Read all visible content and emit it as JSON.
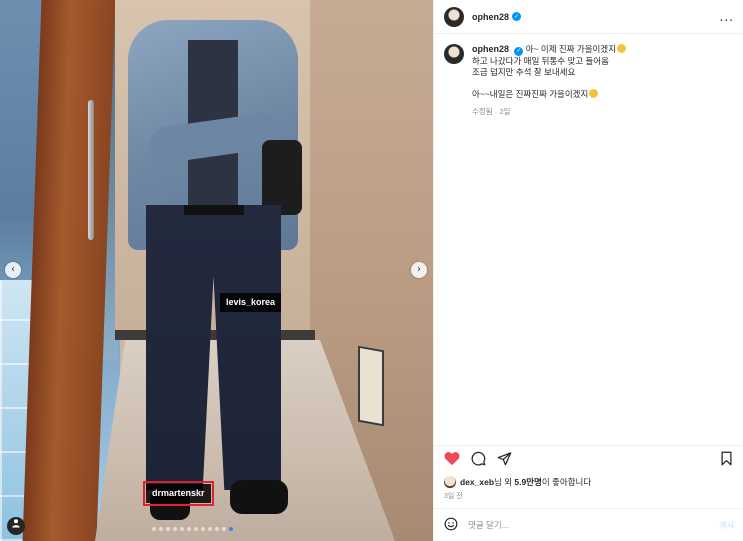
{
  "photo": {
    "tags": [
      {
        "label": "levis_korea"
      },
      {
        "label": "drmartenskr"
      }
    ],
    "carousel": {
      "total_dots": 12,
      "active_index": 11
    },
    "icons": {
      "prev": "chevron-left-icon",
      "next": "chevron-right-icon",
      "tagged_users": "person-icon"
    }
  },
  "post": {
    "header": {
      "username": "ophen28",
      "verified": true,
      "more": "..."
    },
    "caption": {
      "username": "ophen28",
      "line1": "아~ 이제 진짜 가을이겠지",
      "line2": "하고 나갔다가 매일 뒤통수 맞고 들어옴",
      "line3": "조금 덥지만 추석 잘 보내세요",
      "line4": "아~~내일은 진짜진짜 가을이겠지",
      "meta": "수정됨 · 2일"
    },
    "actions": {
      "like": {
        "icon": "heart-icon",
        "liked": true,
        "color": "#ed4956"
      },
      "comment": {
        "icon": "comment-icon"
      },
      "share": {
        "icon": "share-icon"
      },
      "save": {
        "icon": "bookmark-icon"
      }
    },
    "likes": {
      "user": "dex_xeb",
      "mid": "님 외 ",
      "count": "5.9만명",
      "suffix": "이 좋아합니다"
    },
    "time": "3일 전",
    "comment_box": {
      "placeholder": "댓글 달기...",
      "post_label": "게시",
      "emoji_icon": "smiley-icon"
    }
  }
}
